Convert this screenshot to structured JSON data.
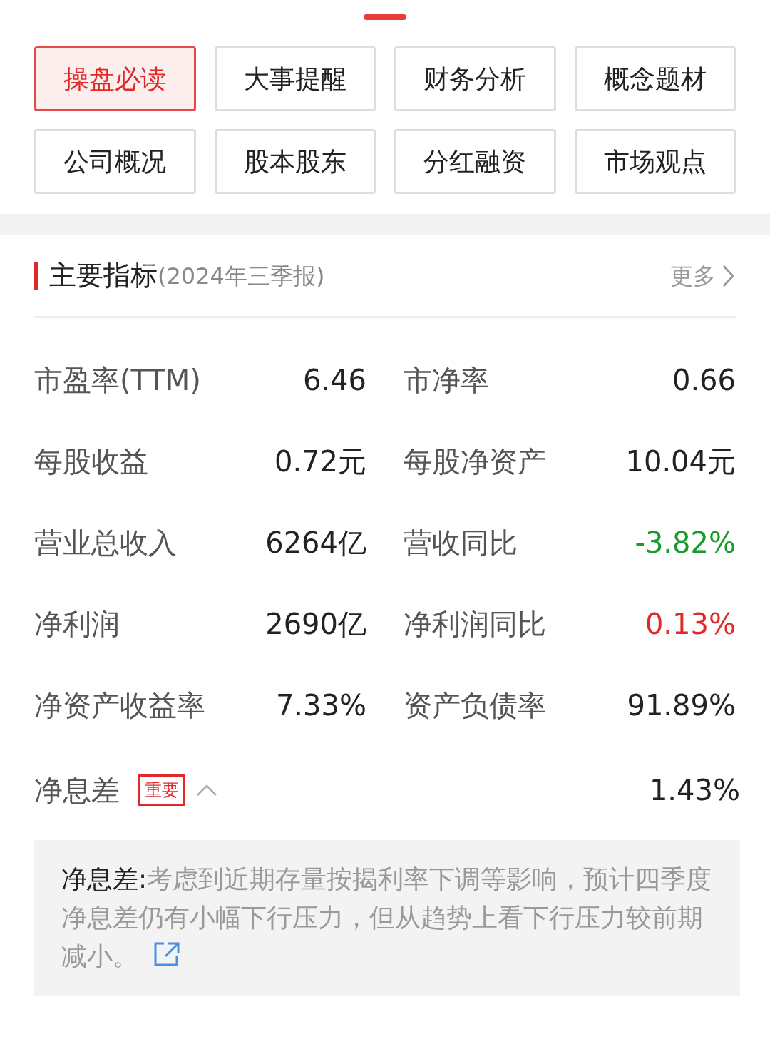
{
  "tabs": [
    {
      "label": "操盘必读",
      "selected": true
    },
    {
      "label": "大事提醒",
      "selected": false
    },
    {
      "label": "财务分析",
      "selected": false
    },
    {
      "label": "概念题材",
      "selected": false
    },
    {
      "label": "公司概况",
      "selected": false
    },
    {
      "label": "股本股东",
      "selected": false
    },
    {
      "label": "分红融资",
      "selected": false
    },
    {
      "label": "市场观点",
      "selected": false
    }
  ],
  "section": {
    "title": "主要指标",
    "subtitle": "(2024年三季报)",
    "more": "更多"
  },
  "metrics": [
    {
      "label": "市盈率(TTM)",
      "value": "6.46",
      "color": "#222222"
    },
    {
      "label": "市净率",
      "value": "0.66",
      "color": "#222222"
    },
    {
      "label": "每股收益",
      "value": "0.72元",
      "color": "#222222"
    },
    {
      "label": "每股净资产",
      "value": "10.04元",
      "color": "#222222"
    },
    {
      "label": "营业总收入",
      "value": "6264亿",
      "color": "#222222"
    },
    {
      "label": "营收同比",
      "value": "-3.82%",
      "color": "#1a9a2a"
    },
    {
      "label": "净利润",
      "value": "2690亿",
      "color": "#222222"
    },
    {
      "label": "净利润同比",
      "value": "0.13%",
      "color": "#e02a2a"
    },
    {
      "label": "净资产收益率",
      "value": "7.33%",
      "color": "#222222"
    },
    {
      "label": "资产负债率",
      "value": "91.89%",
      "color": "#222222"
    }
  ],
  "highlight": {
    "label": "净息差",
    "badge": "重要",
    "expanded": true,
    "value": "1.43%"
  },
  "note": {
    "label": "净息差:",
    "text": "考虑到近期存量按揭利率下调等影响，预计四季度净息差仍有小幅下行压力，但从趋势上看下行压力较前期减小。"
  }
}
